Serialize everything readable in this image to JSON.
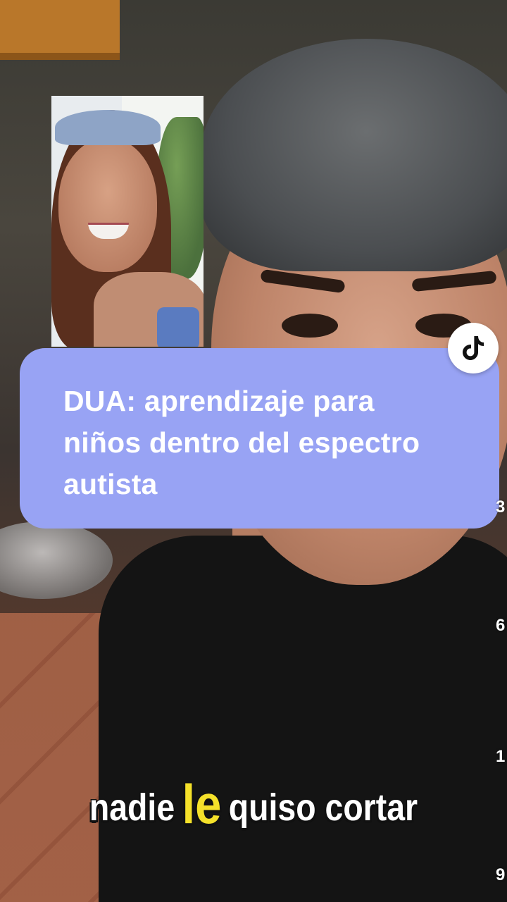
{
  "overlay": {
    "title": "DUA: aprendizaje para niños dentro del espectro autista",
    "card_color": "#98a3f4"
  },
  "badge": {
    "icon": "tiktok-logo-icon"
  },
  "edge_counts": [
    "3",
    "6",
    "1",
    "9"
  ],
  "subtitle": {
    "before": "nadie",
    "highlight": "le",
    "after": "quiso cortar",
    "highlight_color": "#f5e12a"
  }
}
